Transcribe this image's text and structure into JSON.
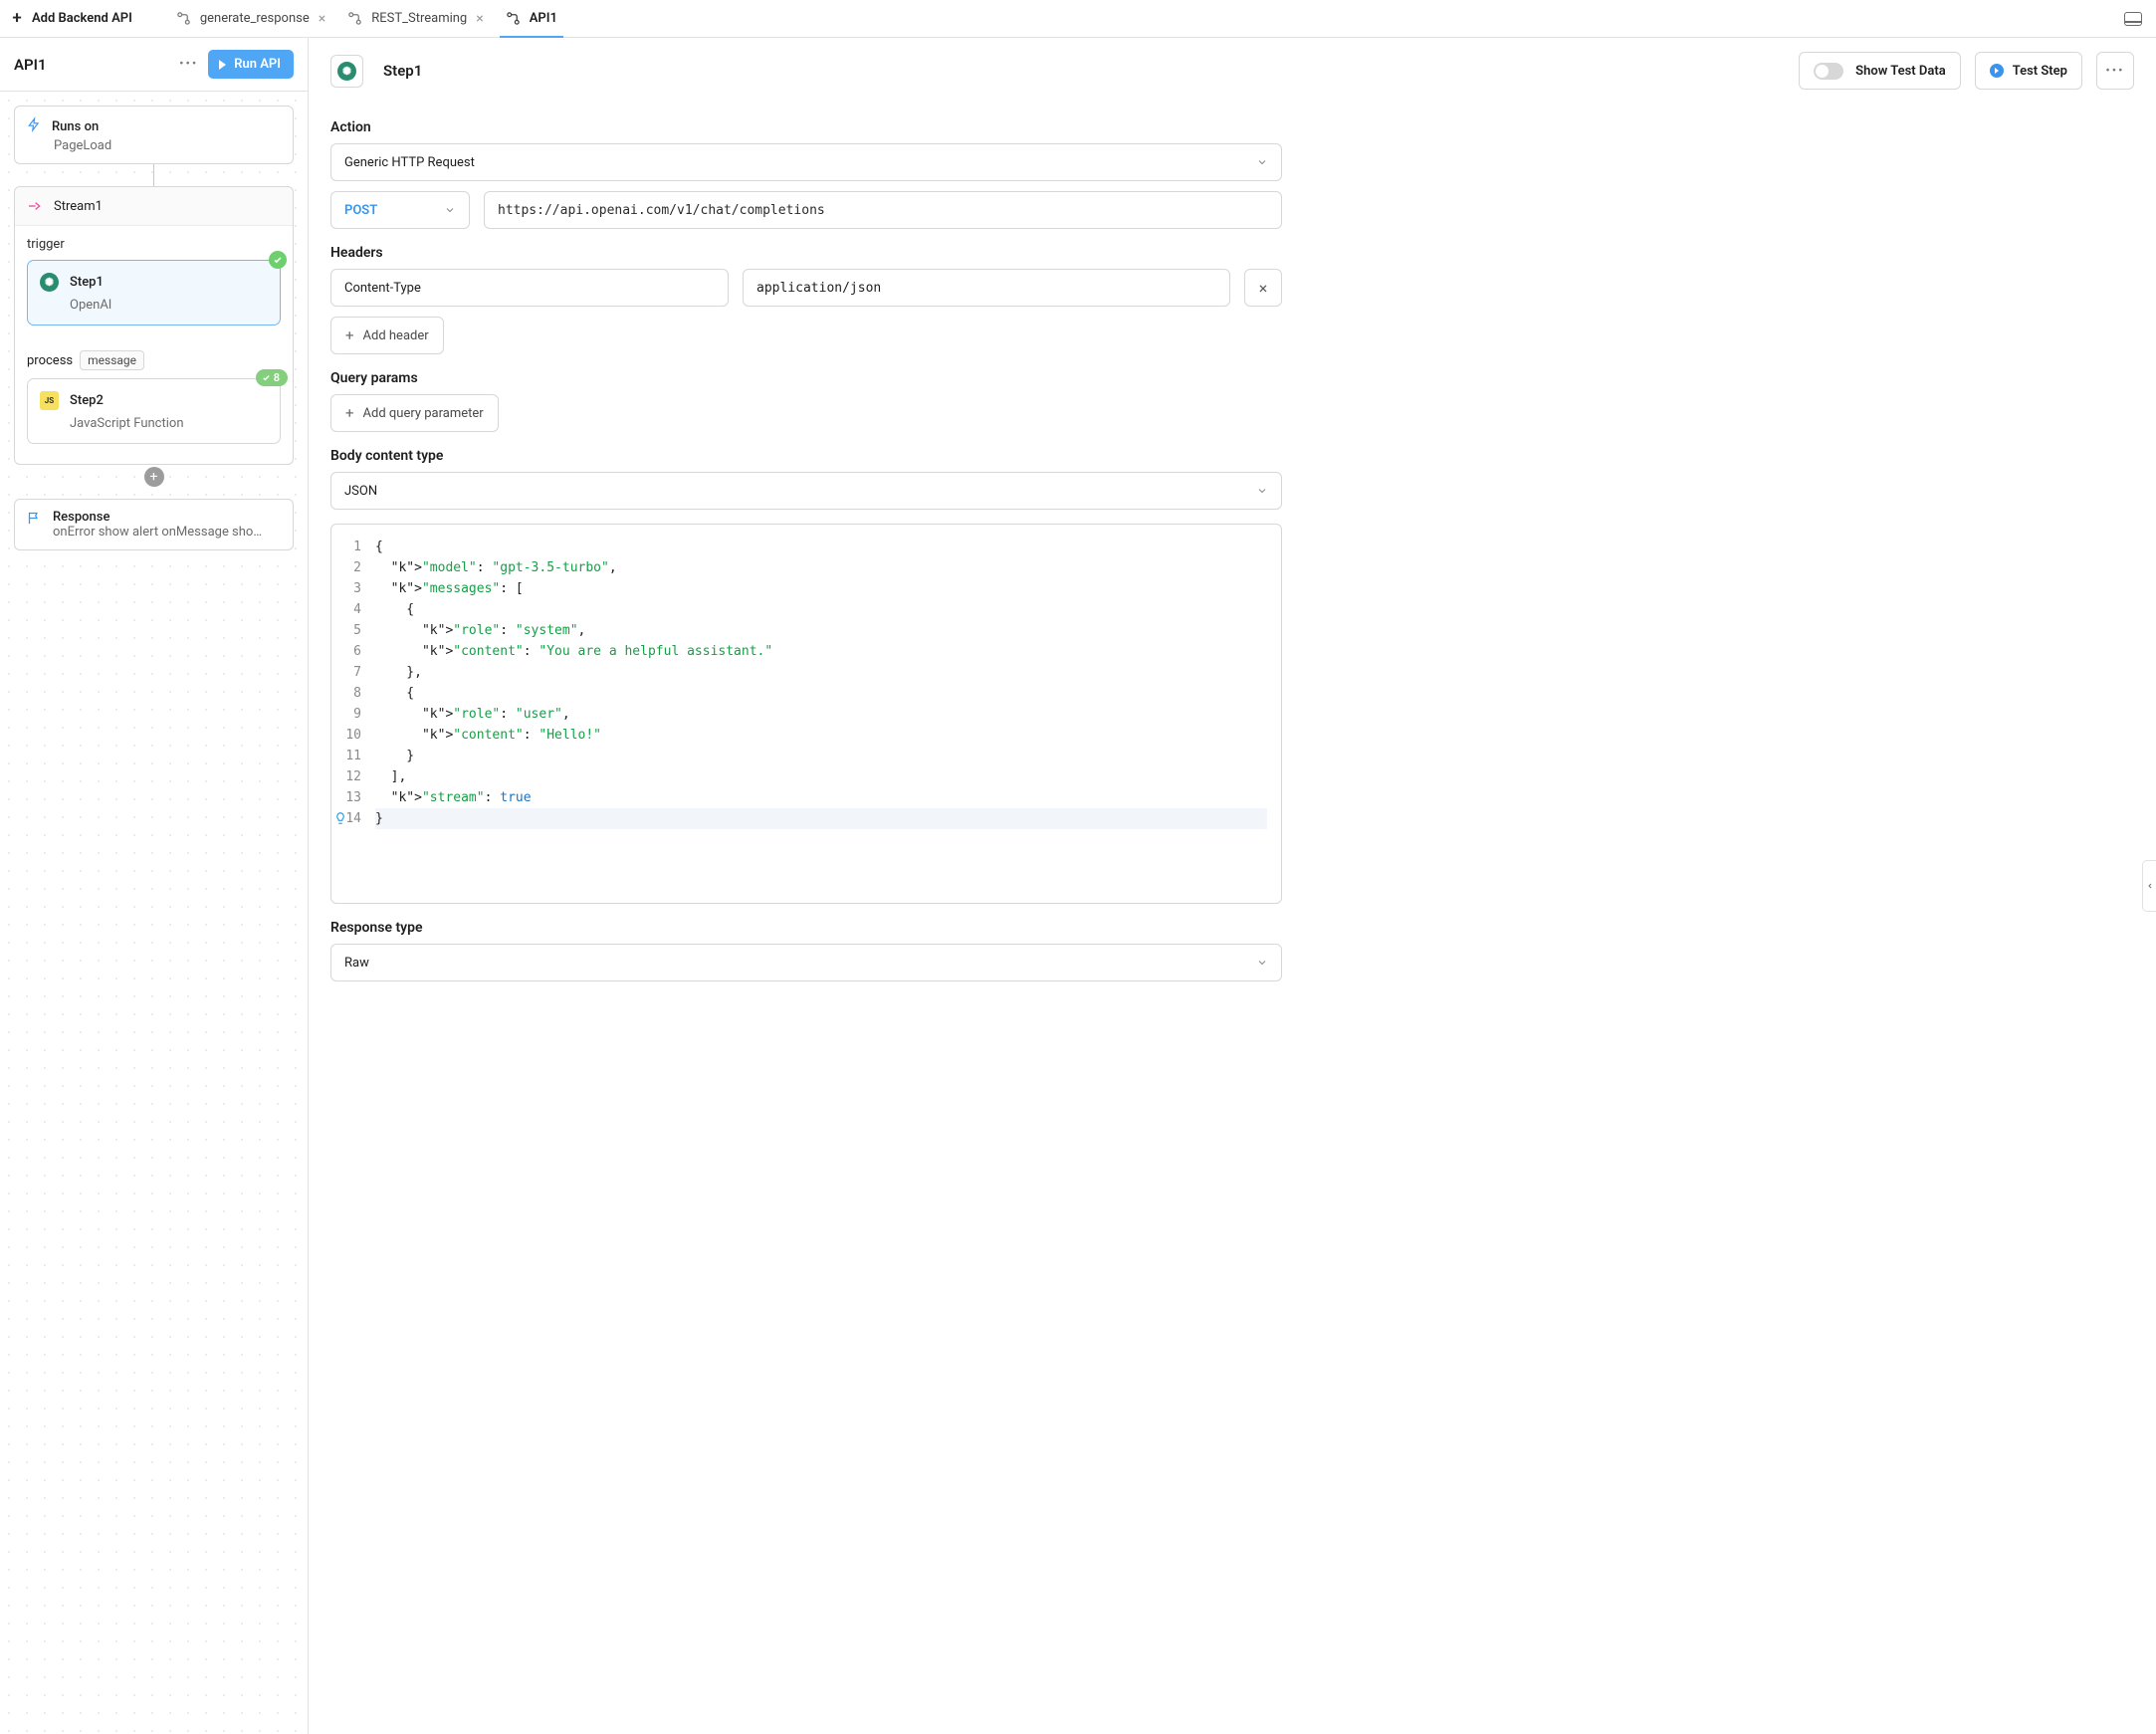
{
  "topbar": {
    "add_label": "Add Backend API",
    "tabs": [
      {
        "label": "generate_response",
        "type": "workflow",
        "closable": true,
        "active": false
      },
      {
        "label": "REST_Streaming",
        "type": "workflow",
        "closable": true,
        "active": false
      },
      {
        "label": "API1",
        "type": "workflow",
        "closable": false,
        "active": true
      }
    ]
  },
  "sidebar": {
    "api_name": "API1",
    "run_label": "Run API",
    "runs_on": {
      "title": "Runs on",
      "value": "PageLoad"
    },
    "stream": {
      "name": "Stream1",
      "trigger_label": "trigger",
      "step1": {
        "name": "Step1",
        "desc": "OpenAI"
      },
      "process_label": "process",
      "process_tag": "message",
      "step2": {
        "name": "Step2",
        "desc": "JavaScript Function",
        "badge": "8"
      }
    },
    "response": {
      "title": "Response",
      "sub": "onError show alert onMessage sho…"
    }
  },
  "main": {
    "step_name": "Step1",
    "show_test_data": "Show Test Data",
    "test_step": "Test Step",
    "action": {
      "title": "Action",
      "value": "Generic HTTP Request"
    },
    "method": "POST",
    "url": "https://api.openai.com/v1/chat/completions",
    "headers_title": "Headers",
    "headers": [
      {
        "name": "Content-Type",
        "value": "application/json"
      }
    ],
    "add_header": "Add header",
    "query_params_title": "Query params",
    "add_query_param": "Add query parameter",
    "body_content_type_title": "Body content type",
    "body_content_type": "JSON",
    "response_type_title": "Response type",
    "response_type": "Raw",
    "code_lines": [
      "{",
      "  \"model\": \"gpt-3.5-turbo\",",
      "  \"messages\": [",
      "    {",
      "      \"role\": \"system\",",
      "      \"content\": \"You are a helpful assistant.\"",
      "    },",
      "    {",
      "      \"role\": \"user\",",
      "      \"content\": \"Hello!\"",
      "    }",
      "  ],",
      "  \"stream\": true",
      "}"
    ],
    "code_body": {
      "model": "gpt-3.5-turbo",
      "messages": [
        {
          "role": "system",
          "content": "You are a helpful assistant."
        },
        {
          "role": "user",
          "content": "Hello!"
        }
      ],
      "stream": true
    }
  }
}
